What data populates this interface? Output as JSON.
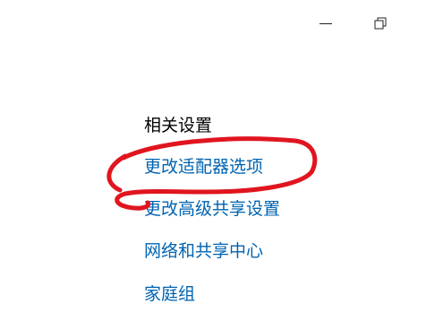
{
  "window": {
    "minimize_label": "—",
    "restore_icon": "restore-icon"
  },
  "related_settings": {
    "title": "相关设置",
    "links": [
      {
        "label": "更改适配器选项"
      },
      {
        "label": "更改高级共享设置"
      },
      {
        "label": "网络和共享中心"
      },
      {
        "label": "家庭组"
      }
    ],
    "partial_link": "...",
    "annotation_color": "#e0151f",
    "link_color": "#0063b1"
  }
}
